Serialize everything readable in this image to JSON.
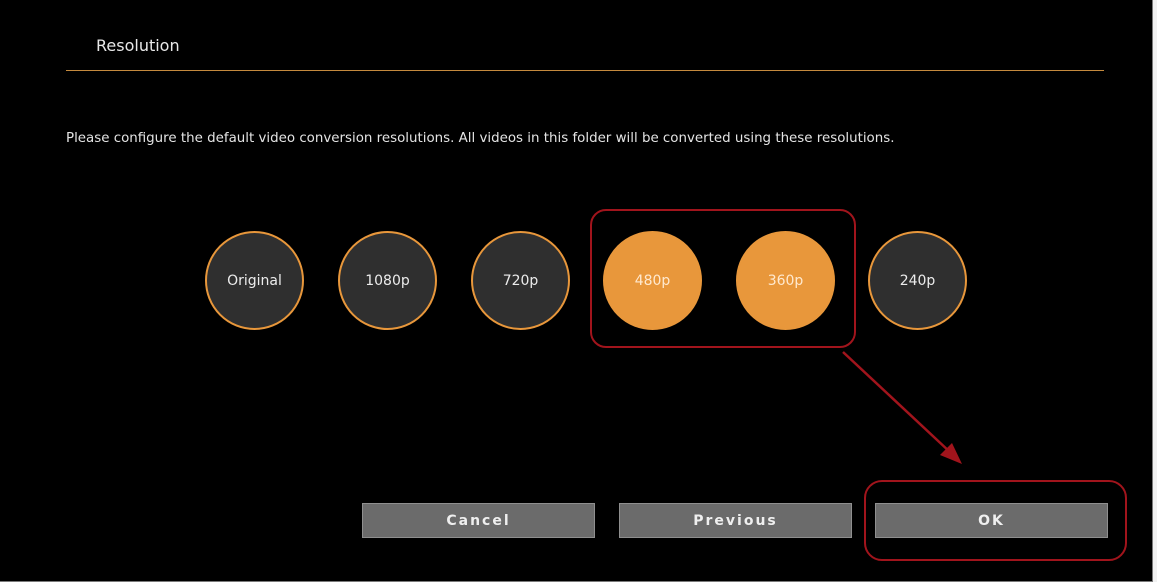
{
  "dialog": {
    "title": "Resolution",
    "description": "Please configure the default video conversion resolutions. All videos in this folder will be converted using these resolutions."
  },
  "resolutions": [
    {
      "label": "Original",
      "selected": false
    },
    {
      "label": "1080p",
      "selected": false
    },
    {
      "label": "720p",
      "selected": false
    },
    {
      "label": "480p",
      "selected": true
    },
    {
      "label": "360p",
      "selected": true
    },
    {
      "label": "240p",
      "selected": false
    }
  ],
  "buttons": {
    "cancel": "Cancel",
    "previous": "Previous",
    "ok": "OK"
  },
  "colors": {
    "accent": "#e8973b",
    "annotation": "#a1141c",
    "background": "#000000",
    "button": "#6b6b6b"
  }
}
